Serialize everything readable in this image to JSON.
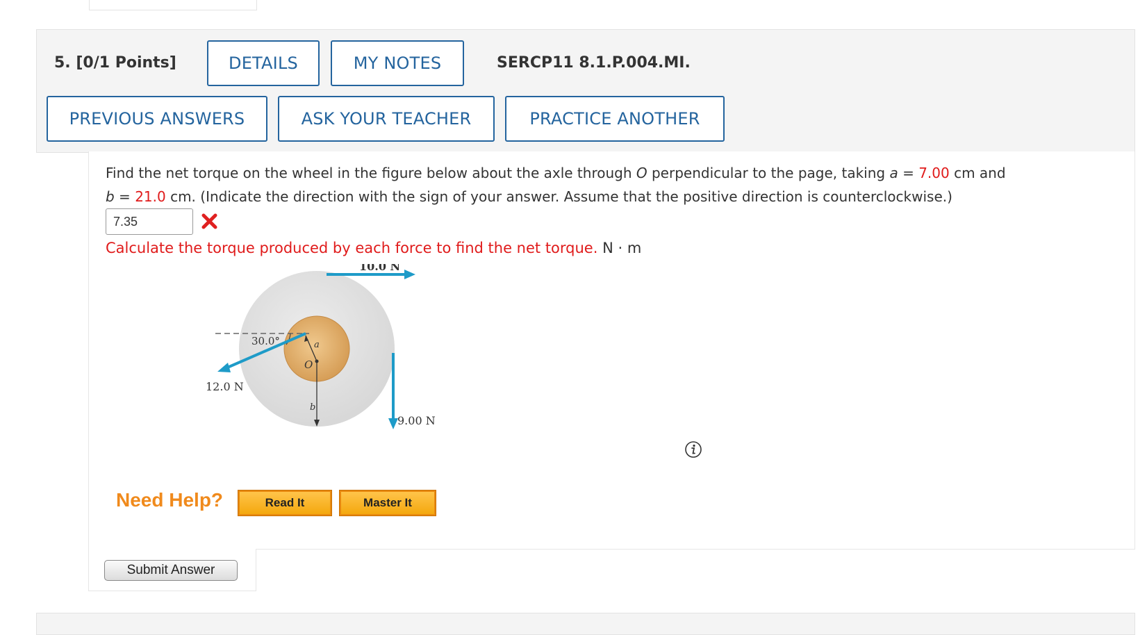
{
  "question": {
    "number": "5.",
    "points": "[0/1 Points]",
    "code": "SERCP11 8.1.P.004.MI."
  },
  "buttons": {
    "details": "DETAILS",
    "my_notes": "MY NOTES",
    "previous_answers": "PREVIOUS ANSWERS",
    "ask_your_teacher": "ASK YOUR TEACHER",
    "practice_another": "PRACTICE ANOTHER"
  },
  "prompt": {
    "text1": "Find the net torque on the wheel in the figure below about the axle through ",
    "axle": "O",
    "text2": " perpendicular to the page, taking ",
    "var_a": "a",
    "eq": " = ",
    "a_value": "7.00",
    "text3": " cm and",
    "var_b": "b",
    "b_value": "21.0",
    "text4": " cm. (Indicate the direction with the sign of your answer. Assume that the positive direction is counterclockwise.)"
  },
  "answer": {
    "value": "7.35",
    "status": "incorrect",
    "feedback": "Calculate the torque produced by each force to find the net torque.",
    "unit": "N · m"
  },
  "figure": {
    "force_top": "10.0 N",
    "force_left": "12.0 N",
    "force_right": "9.00 N",
    "angle": "30.0°",
    "label_a": "a",
    "label_b": "b",
    "label_o": "O",
    "arrow_color": "#1e9bc8",
    "wheel_color": "#dcdcdc",
    "axle_color": "#d9a05c"
  },
  "help": {
    "label": "Need Help?",
    "read_it": "Read It",
    "master_it": "Master It"
  },
  "submit": {
    "label": "Submit Answer"
  }
}
